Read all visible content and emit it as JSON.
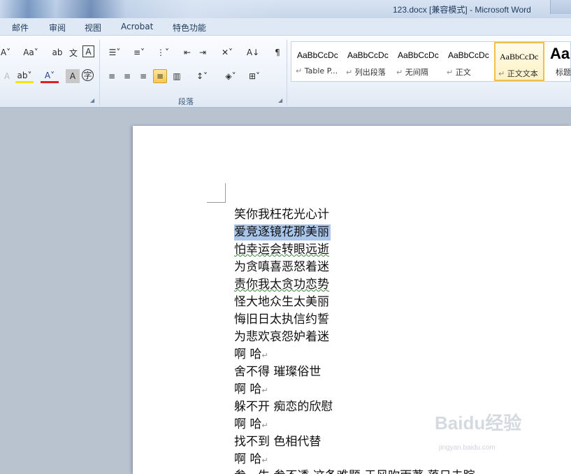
{
  "window": {
    "title": "123.docx [兼容模式] - Microsoft Word"
  },
  "tabs": [
    "邮件",
    "审阅",
    "视图",
    "Acrobat",
    "特色功能"
  ],
  "ribbon": {
    "paragraph_group_label": "段落",
    "styles": [
      {
        "sample": "AaBbCcDc",
        "name": "Table P..."
      },
      {
        "sample": "AaBbCcDc",
        "name": "列出段落"
      },
      {
        "sample": "AaBbCcDc",
        "name": "无间隔"
      },
      {
        "sample": "AaBbCcDc",
        "name": "正文"
      },
      {
        "sample": "AaBbCcDc",
        "name": "正文文本"
      },
      {
        "sample": "Aa",
        "name": "标题"
      }
    ],
    "selected_style_index": 4
  },
  "document": {
    "lines": [
      "笑你我枉花光心计",
      "爱竞逐镜花那美丽",
      "怕幸运会转眼远逝",
      "为贪嗔喜恶怒着迷",
      "责你我太贪功恋势",
      "怪大地众生太美丽",
      "悔旧日太执信约誓",
      "为悲欢哀怨妒着迷",
      "啊  哈",
      "舍不得  璀璨俗世",
      "啊  哈",
      "躲不开  痴恋的欣慰",
      "啊  哈",
      "找不到  色相代替",
      "啊  哈",
      "参一生  参不透  这条难题  于风吹雨著  落日去踪"
    ],
    "selected_line_index": 1,
    "paragraph_mark": "↵"
  },
  "watermark": {
    "logo": "Baidu经验",
    "url": "jingyan.baidu.com"
  }
}
